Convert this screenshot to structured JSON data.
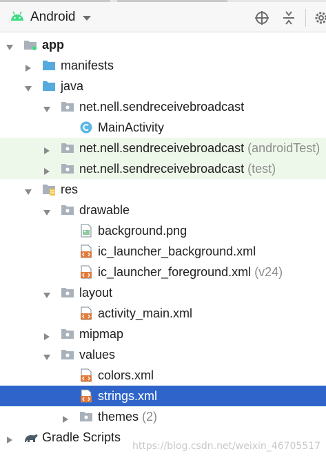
{
  "colors": {
    "selection": "#2f65ca",
    "test_highlight": "#eef8ea",
    "folder_blue": "#56aadd",
    "package_gray": "#a9b2ba",
    "xml_orange": "#e07c3e",
    "android_green": "#3ddc84",
    "class_circle": "#5cb8e6"
  },
  "toolbar": {
    "title": "Android",
    "icons": [
      "android-icon",
      "chevron-down-icon",
      "crosshair-icon",
      "collapse-all-icon",
      "gear-icon"
    ]
  },
  "tree": [
    {
      "name": "app",
      "label": "app",
      "suffix": "",
      "level": 0,
      "arrow": "expanded",
      "icon": "module-icon",
      "bold": true
    },
    {
      "name": "manifests",
      "label": "manifests",
      "suffix": "",
      "level": 1,
      "arrow": "collapsed",
      "icon": "folder-icon"
    },
    {
      "name": "java",
      "label": "java",
      "suffix": "",
      "level": 1,
      "arrow": "expanded",
      "icon": "folder-icon"
    },
    {
      "name": "package-main",
      "label": "net.nell.sendreceivebroadcast",
      "suffix": "",
      "level": 2,
      "arrow": "expanded",
      "icon": "package-icon"
    },
    {
      "name": "main-activity",
      "label": "MainActivity",
      "suffix": "",
      "level": 3,
      "arrow": "none",
      "icon": "class-icon"
    },
    {
      "name": "package-android-test",
      "label": "net.nell.sendreceivebroadcast",
      "suffix": "(androidTest)",
      "level": 2,
      "arrow": "collapsed",
      "icon": "package-icon",
      "green": true
    },
    {
      "name": "package-test",
      "label": "net.nell.sendreceivebroadcast",
      "suffix": "(test)",
      "level": 2,
      "arrow": "collapsed",
      "icon": "package-icon",
      "green": true
    },
    {
      "name": "res",
      "label": "res",
      "suffix": "",
      "level": 1,
      "arrow": "expanded",
      "icon": "res-folder-icon"
    },
    {
      "name": "drawable",
      "label": "drawable",
      "suffix": "",
      "level": 2,
      "arrow": "expanded",
      "icon": "package-icon"
    },
    {
      "name": "background-png",
      "label": "background.png",
      "suffix": "",
      "level": 3,
      "arrow": "none",
      "icon": "image-file-icon"
    },
    {
      "name": "ic-launcher-background",
      "label": "ic_launcher_background.xml",
      "suffix": "",
      "level": 3,
      "arrow": "none",
      "icon": "xml-file-icon"
    },
    {
      "name": "ic-launcher-foreground",
      "label": "ic_launcher_foreground.xml",
      "suffix": "(v24)",
      "level": 3,
      "arrow": "none",
      "icon": "xml-file-icon"
    },
    {
      "name": "layout",
      "label": "layout",
      "suffix": "",
      "level": 2,
      "arrow": "expanded",
      "icon": "package-icon"
    },
    {
      "name": "activity-main",
      "label": "activity_main.xml",
      "suffix": "",
      "level": 3,
      "arrow": "none",
      "icon": "xml-file-icon"
    },
    {
      "name": "mipmap",
      "label": "mipmap",
      "suffix": "",
      "level": 2,
      "arrow": "collapsed",
      "icon": "package-icon"
    },
    {
      "name": "values",
      "label": "values",
      "suffix": "",
      "level": 2,
      "arrow": "expanded",
      "icon": "package-icon"
    },
    {
      "name": "colors-xml",
      "label": "colors.xml",
      "suffix": "",
      "level": 3,
      "arrow": "none",
      "icon": "xml-file-icon"
    },
    {
      "name": "strings-xml",
      "label": "strings.xml",
      "suffix": "",
      "level": 3,
      "arrow": "none",
      "icon": "xml-file-icon",
      "selected": true
    },
    {
      "name": "themes",
      "label": "themes",
      "suffix": "(2)",
      "level": 3,
      "arrow": "collapsed",
      "icon": "package-icon"
    },
    {
      "name": "gradle-scripts",
      "label": "Gradle Scripts",
      "suffix": "",
      "level": 0,
      "arrow": "collapsed",
      "icon": "gradle-icon"
    }
  ],
  "watermark": "https://blog.csdn.net/weixin_46705517"
}
